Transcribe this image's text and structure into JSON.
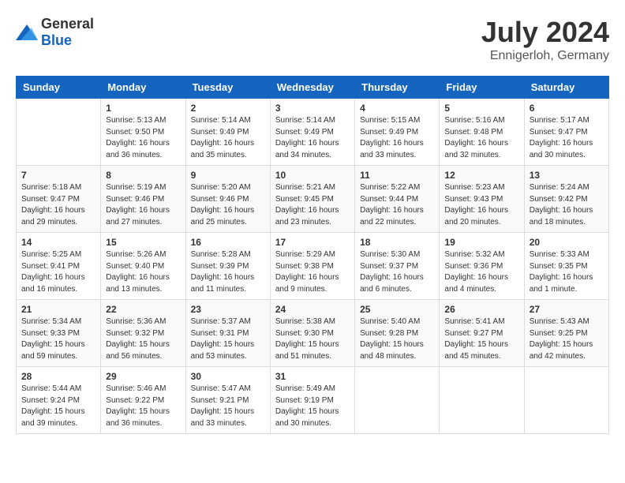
{
  "logo": {
    "general": "General",
    "blue": "Blue"
  },
  "title": {
    "month_year": "July 2024",
    "location": "Ennigerloh, Germany"
  },
  "calendar": {
    "headers": [
      "Sunday",
      "Monday",
      "Tuesday",
      "Wednesday",
      "Thursday",
      "Friday",
      "Saturday"
    ],
    "weeks": [
      [
        {
          "day": "",
          "info": ""
        },
        {
          "day": "1",
          "info": "Sunrise: 5:13 AM\nSunset: 9:50 PM\nDaylight: 16 hours\nand 36 minutes."
        },
        {
          "day": "2",
          "info": "Sunrise: 5:14 AM\nSunset: 9:49 PM\nDaylight: 16 hours\nand 35 minutes."
        },
        {
          "day": "3",
          "info": "Sunrise: 5:14 AM\nSunset: 9:49 PM\nDaylight: 16 hours\nand 34 minutes."
        },
        {
          "day": "4",
          "info": "Sunrise: 5:15 AM\nSunset: 9:49 PM\nDaylight: 16 hours\nand 33 minutes."
        },
        {
          "day": "5",
          "info": "Sunrise: 5:16 AM\nSunset: 9:48 PM\nDaylight: 16 hours\nand 32 minutes."
        },
        {
          "day": "6",
          "info": "Sunrise: 5:17 AM\nSunset: 9:47 PM\nDaylight: 16 hours\nand 30 minutes."
        }
      ],
      [
        {
          "day": "7",
          "info": "Sunrise: 5:18 AM\nSunset: 9:47 PM\nDaylight: 16 hours\nand 29 minutes."
        },
        {
          "day": "8",
          "info": "Sunrise: 5:19 AM\nSunset: 9:46 PM\nDaylight: 16 hours\nand 27 minutes."
        },
        {
          "day": "9",
          "info": "Sunrise: 5:20 AM\nSunset: 9:46 PM\nDaylight: 16 hours\nand 25 minutes."
        },
        {
          "day": "10",
          "info": "Sunrise: 5:21 AM\nSunset: 9:45 PM\nDaylight: 16 hours\nand 23 minutes."
        },
        {
          "day": "11",
          "info": "Sunrise: 5:22 AM\nSunset: 9:44 PM\nDaylight: 16 hours\nand 22 minutes."
        },
        {
          "day": "12",
          "info": "Sunrise: 5:23 AM\nSunset: 9:43 PM\nDaylight: 16 hours\nand 20 minutes."
        },
        {
          "day": "13",
          "info": "Sunrise: 5:24 AM\nSunset: 9:42 PM\nDaylight: 16 hours\nand 18 minutes."
        }
      ],
      [
        {
          "day": "14",
          "info": "Sunrise: 5:25 AM\nSunset: 9:41 PM\nDaylight: 16 hours\nand 16 minutes."
        },
        {
          "day": "15",
          "info": "Sunrise: 5:26 AM\nSunset: 9:40 PM\nDaylight: 16 hours\nand 13 minutes."
        },
        {
          "day": "16",
          "info": "Sunrise: 5:28 AM\nSunset: 9:39 PM\nDaylight: 16 hours\nand 11 minutes."
        },
        {
          "day": "17",
          "info": "Sunrise: 5:29 AM\nSunset: 9:38 PM\nDaylight: 16 hours\nand 9 minutes."
        },
        {
          "day": "18",
          "info": "Sunrise: 5:30 AM\nSunset: 9:37 PM\nDaylight: 16 hours\nand 6 minutes."
        },
        {
          "day": "19",
          "info": "Sunrise: 5:32 AM\nSunset: 9:36 PM\nDaylight: 16 hours\nand 4 minutes."
        },
        {
          "day": "20",
          "info": "Sunrise: 5:33 AM\nSunset: 9:35 PM\nDaylight: 16 hours\nand 1 minute."
        }
      ],
      [
        {
          "day": "21",
          "info": "Sunrise: 5:34 AM\nSunset: 9:33 PM\nDaylight: 15 hours\nand 59 minutes."
        },
        {
          "day": "22",
          "info": "Sunrise: 5:36 AM\nSunset: 9:32 PM\nDaylight: 15 hours\nand 56 minutes."
        },
        {
          "day": "23",
          "info": "Sunrise: 5:37 AM\nSunset: 9:31 PM\nDaylight: 15 hours\nand 53 minutes."
        },
        {
          "day": "24",
          "info": "Sunrise: 5:38 AM\nSunset: 9:30 PM\nDaylight: 15 hours\nand 51 minutes."
        },
        {
          "day": "25",
          "info": "Sunrise: 5:40 AM\nSunset: 9:28 PM\nDaylight: 15 hours\nand 48 minutes."
        },
        {
          "day": "26",
          "info": "Sunrise: 5:41 AM\nSunset: 9:27 PM\nDaylight: 15 hours\nand 45 minutes."
        },
        {
          "day": "27",
          "info": "Sunrise: 5:43 AM\nSunset: 9:25 PM\nDaylight: 15 hours\nand 42 minutes."
        }
      ],
      [
        {
          "day": "28",
          "info": "Sunrise: 5:44 AM\nSunset: 9:24 PM\nDaylight: 15 hours\nand 39 minutes."
        },
        {
          "day": "29",
          "info": "Sunrise: 5:46 AM\nSunset: 9:22 PM\nDaylight: 15 hours\nand 36 minutes."
        },
        {
          "day": "30",
          "info": "Sunrise: 5:47 AM\nSunset: 9:21 PM\nDaylight: 15 hours\nand 33 minutes."
        },
        {
          "day": "31",
          "info": "Sunrise: 5:49 AM\nSunset: 9:19 PM\nDaylight: 15 hours\nand 30 minutes."
        },
        {
          "day": "",
          "info": ""
        },
        {
          "day": "",
          "info": ""
        },
        {
          "day": "",
          "info": ""
        }
      ]
    ]
  }
}
